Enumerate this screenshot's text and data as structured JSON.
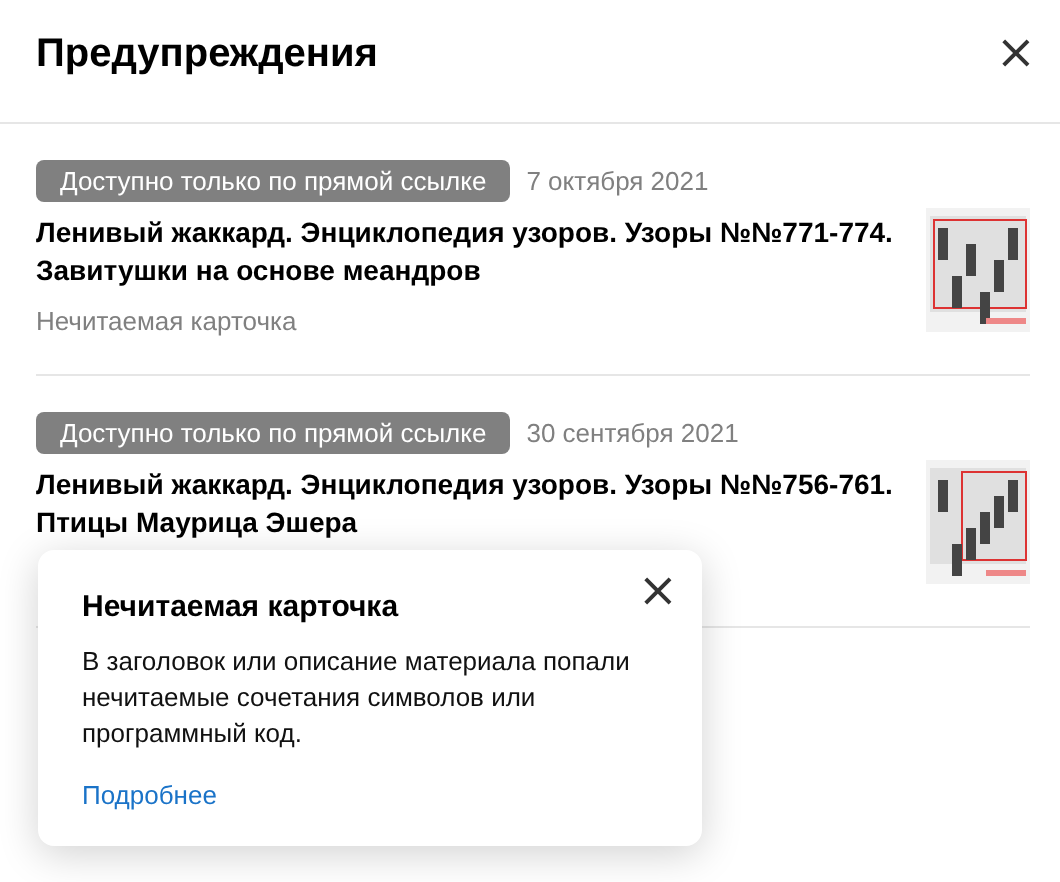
{
  "header": {
    "title": "Предупреждения",
    "close": "×"
  },
  "items": [
    {
      "badge": "Доступно только по прямой ссылке",
      "date": "7 октября 2021",
      "title": "Ленивый жаккард. Энциклопедия узоров. Узоры №№771-774. Завитушки на основе меандров",
      "note": "Нечитаемая карточка"
    },
    {
      "badge": "Доступно только по прямой ссылке",
      "date": "30 сентября 2021",
      "title": "Ленивый жаккард. Энциклопедия узоров. Узоры №№756-761. Птицы Маурица Эшера"
    }
  ],
  "popover": {
    "title": "Нечитаемая карточка",
    "text": "В заголовок или описание материала попали нечитаемые сочетания символов или программный код.",
    "link": "Подробнее",
    "close": "×"
  }
}
